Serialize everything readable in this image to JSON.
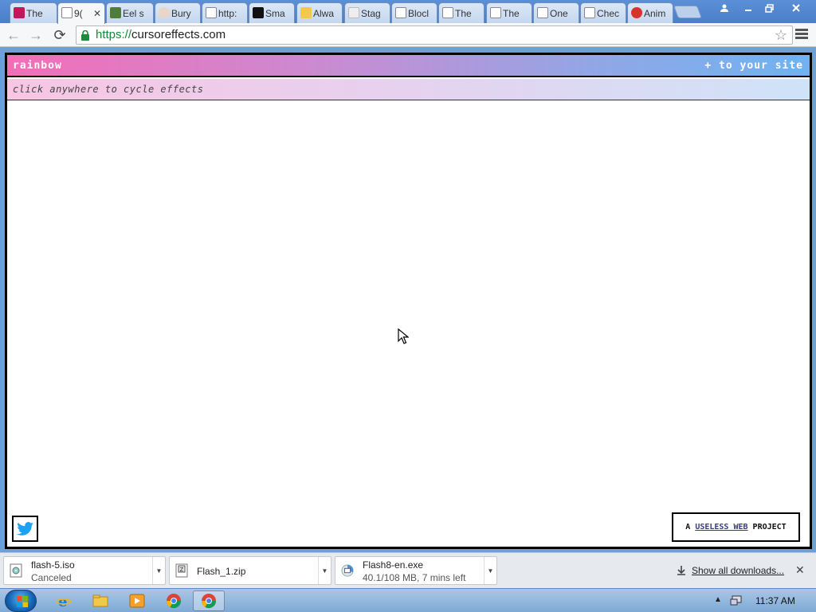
{
  "browser": {
    "tabs": [
      {
        "label": "The",
        "favicon_color": "#c2185b"
      },
      {
        "label": "9(",
        "favicon_color": "#ffffff",
        "active": true
      },
      {
        "label": "Eel s",
        "favicon_color": "#4e7d3a"
      },
      {
        "label": "Bury",
        "favicon_color": "#e9d6c8"
      },
      {
        "label": "http:",
        "favicon_color": "#ffffff"
      },
      {
        "label": "Sma",
        "favicon_color": "#111111"
      },
      {
        "label": "Alwa",
        "favicon_color": "#f2c94c"
      },
      {
        "label": "Stag",
        "favicon_color": "#eeeeee"
      },
      {
        "label": "Blocl",
        "favicon_color": "#ffffff"
      },
      {
        "label": "The",
        "favicon_color": "#ffffff"
      },
      {
        "label": "The",
        "favicon_color": "#ffffff"
      },
      {
        "label": "One",
        "favicon_color": "#ffffff"
      },
      {
        "label": "Chec",
        "favicon_color": "#ffffff"
      },
      {
        "label": "Anim",
        "favicon_color": "#d8332a"
      }
    ],
    "url_scheme": "https://",
    "url_host": "cursoreffects.com"
  },
  "page": {
    "brand": "rainbow",
    "to_site": "+ to your site",
    "hint": "click anywhere to cycle effects",
    "footer_prefix": "A",
    "footer_link": "USELESS WEB",
    "footer_suffix": "PROJECT"
  },
  "downloads": {
    "items": [
      {
        "name": "flash-5.iso",
        "status": "Canceled"
      },
      {
        "name": "Flash_1.zip",
        "status": ""
      },
      {
        "name": "Flash8-en.exe",
        "status": "40.1/108 MB, 7 mins left"
      }
    ],
    "show_all": "Show all downloads..."
  },
  "taskbar": {
    "clock": "11:37 AM"
  },
  "colors": {
    "header_gradient": [
      "#f36eb7",
      "#c98bd2",
      "#8fa8e6",
      "#6fb2f2"
    ],
    "twitter_blue": "#1da1f2"
  }
}
